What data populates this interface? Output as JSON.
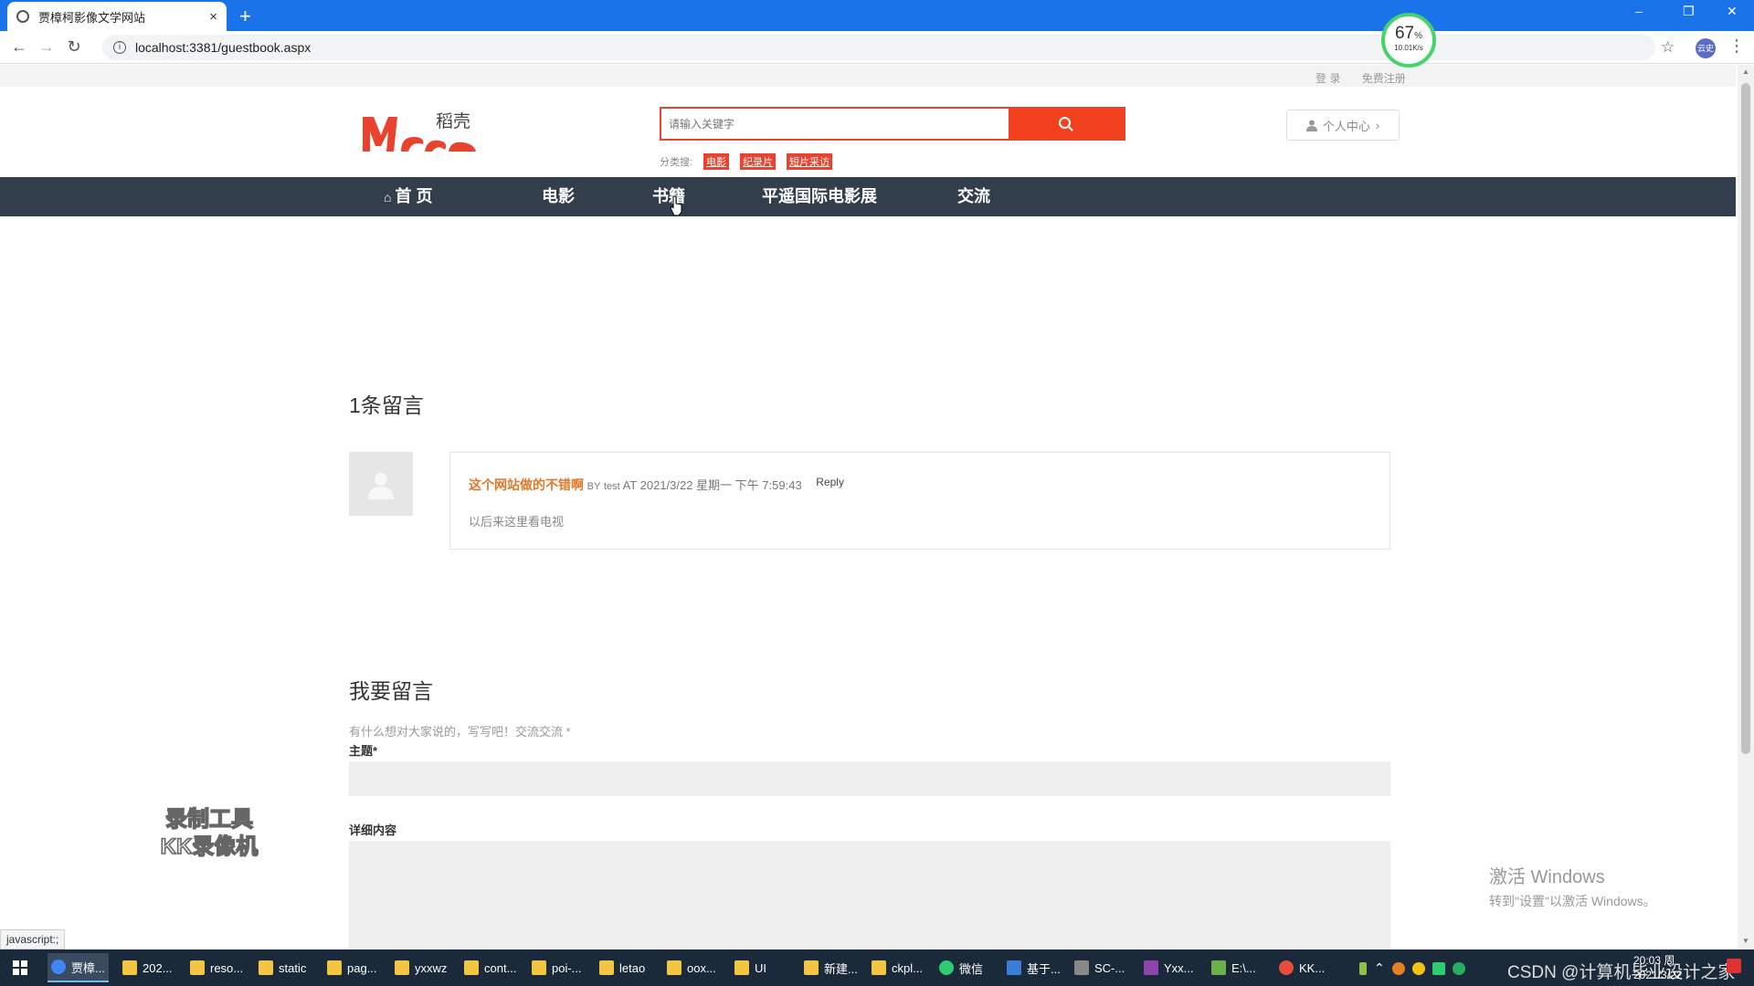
{
  "browser": {
    "tab_title": "贾樟柯影像文学网站",
    "tab_close": "×",
    "new_tab": "+",
    "url": "localhost:3381/guestbook.aspx",
    "profile_label": "云史"
  },
  "speed_monitor": {
    "percent": "67",
    "percent_unit": "%",
    "rate": "10.01K/s"
  },
  "site": {
    "top_links": [
      "登 录",
      "免费注册"
    ],
    "logo_text": "稻壳",
    "search_placeholder": "请输入关键字",
    "category_label": "分类搜:",
    "category_tags": [
      "电影",
      "纪录片",
      "短片采访"
    ],
    "user_center": "个人中心",
    "user_center_arrow": "›",
    "nav": {
      "home": "首 页",
      "movies": "电影",
      "books": "书籍",
      "festival": "平遥国际电影展",
      "exchange": "交流"
    }
  },
  "comments": {
    "count_title": "1条留言",
    "items": [
      {
        "title": "这个网站做的不错啊",
        "by_label": "BY",
        "author": "test",
        "at_label": "AT",
        "time": "2021/3/22 星期一 下午 7:59:43",
        "reply": "Reply",
        "body": "以后来这里看电视"
      }
    ]
  },
  "form": {
    "title": "我要留言",
    "hint": "有什么想对大家说的，写写吧！交流交流 *",
    "subject_label": "主题*",
    "content_label": "详细内容"
  },
  "overlays": {
    "watermark_line1": "录制工具",
    "watermark_line2": "KK录像机",
    "activate_title": "激活 Windows",
    "activate_sub": "转到\"设置\"以激活 Windows。",
    "status_url": "javascript:;"
  },
  "taskbar": {
    "items": [
      "贾樟...",
      "202...",
      "reso...",
      "static",
      "pag...",
      "yxxwz",
      "cont...",
      "poi-...",
      "letao",
      "oox...",
      "UI",
      "新建...",
      "ckpl...",
      "微信",
      "基于...",
      "SC-...",
      "Yxx...",
      "E:\\...",
      "KK..."
    ],
    "csdn_text": "CSDN @计算机毕业设计之家",
    "time": "20:03 周",
    "date": "2021/3/22"
  },
  "colors": {
    "accent_red": "#e8432e",
    "nav_bg": "#333e4d",
    "comment_title": "#e0782a",
    "chrome_blue": "#1a73e8"
  }
}
